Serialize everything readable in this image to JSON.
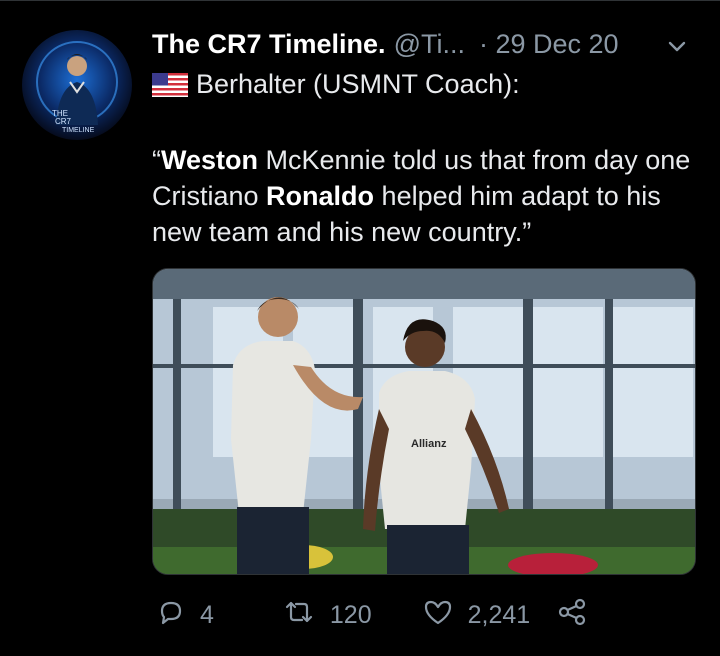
{
  "tweet": {
    "author_name": "The CR7 Timeline.",
    "author_handle": "@Ti...",
    "date": "· 29 Dec 20",
    "line1": "Berhalter (USMNT Coach):",
    "quote_open": "“",
    "bold1": "Weston",
    "seg1": " McKennie told us that from day one Cristiano ",
    "bold2": "Ronaldo",
    "seg2": " helped him adapt to his new team and his new country.”",
    "flag_icon": "us-flag-icon",
    "avatar_text": [
      "THE",
      "CR7",
      "TIMELINE"
    ],
    "shirt_sponsor": "Allianz",
    "accent_color": "#8b98a5"
  },
  "actions": {
    "reply_count": "4",
    "retweet_count": "120",
    "like_count": "2,241"
  }
}
